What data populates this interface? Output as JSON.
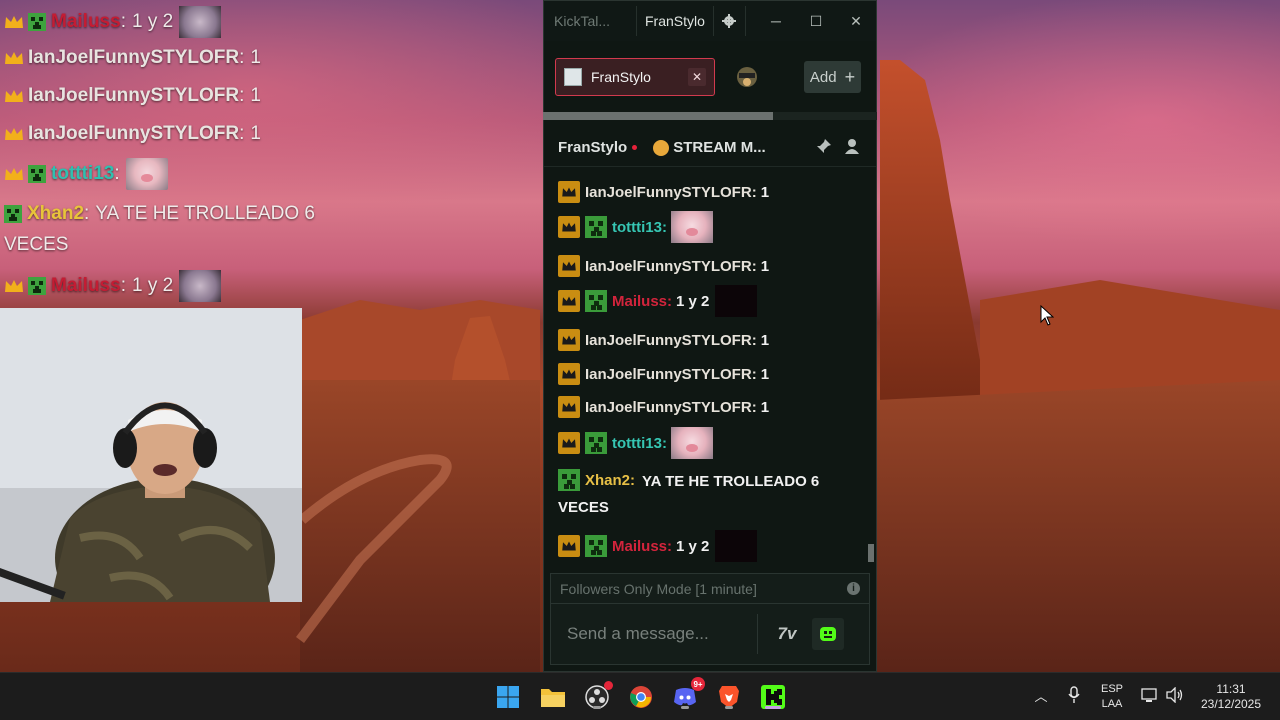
{
  "overlay_chat": {
    "lines": [
      {
        "user": "Mailuss",
        "sep": ":",
        "text": "1 y 2"
      },
      {
        "user": "IanJoelFunnySTYLOFR",
        "sep": ":",
        "text": "1"
      },
      {
        "user": "IanJoelFunnySTYLOFR",
        "sep": ":",
        "text": "1"
      },
      {
        "user": "IanJoelFunnySTYLOFR",
        "sep": ":",
        "text": "1"
      },
      {
        "user": "tottti13",
        "sep": ":",
        "text": ""
      },
      {
        "user": "Xhan2",
        "sep": ":",
        "text": "YA TE HE TROLLEADO 6"
      },
      {
        "user": "",
        "sep": "",
        "text": "VECES"
      },
      {
        "user": "Mailuss",
        "sep": ":",
        "text": "1 y 2"
      }
    ]
  },
  "kicktalk": {
    "app_title": "KickTal...",
    "current_user": "FranStylo",
    "tabs": [
      {
        "label": "FranStylo",
        "active": true
      },
      {
        "label": "",
        "active": false
      }
    ],
    "add_button": "Add",
    "channel": {
      "name": "FranStylo",
      "stream_title": "STREAM M..."
    },
    "messages": [
      {
        "badges": [
          "crown"
        ],
        "user": "IanJoelFunnySTYLOFR",
        "color": "gold",
        "text": "1"
      },
      {
        "badges": [
          "crown",
          "creeper"
        ],
        "user": "tottti13",
        "color": "teal",
        "text": "",
        "emote": "pig"
      },
      {
        "badges": [
          "crown"
        ],
        "user": "IanJoelFunnySTYLOFR",
        "color": "gold",
        "text": "1"
      },
      {
        "badges": [
          "crown",
          "creeper"
        ],
        "user": "Mailuss",
        "color": "red",
        "text": "1 y 2",
        "emote": "dark"
      },
      {
        "badges": [
          "crown"
        ],
        "user": "IanJoelFunnySTYLOFR",
        "color": "gold",
        "text": "1"
      },
      {
        "badges": [
          "crown"
        ],
        "user": "IanJoelFunnySTYLOFR",
        "color": "gold",
        "text": "1"
      },
      {
        "badges": [
          "crown"
        ],
        "user": "IanJoelFunnySTYLOFR",
        "color": "gold",
        "text": "1"
      },
      {
        "badges": [
          "crown",
          "creeper"
        ],
        "user": "tottti13",
        "color": "teal",
        "text": "",
        "emote": "pig"
      },
      {
        "badges": [
          "creeper"
        ],
        "user": "Xhan2",
        "color": "yellow",
        "text": "YA TE HE TROLLEADO 6 VECES"
      },
      {
        "badges": [
          "crown",
          "creeper"
        ],
        "user": "Mailuss",
        "color": "red",
        "text": "1 y 2",
        "emote": "dark"
      }
    ],
    "followers_mode": "Followers Only Mode [1 minute]",
    "input_placeholder": "Send a message...",
    "emote_button_7tv": "7v"
  },
  "taskbar": {
    "apps": [
      "start",
      "file-explorer",
      "obs",
      "chrome",
      "discord",
      "brave",
      "kicktalk"
    ],
    "discord_badge": "9+",
    "language_top": "ESP",
    "language_bottom": "LAA",
    "time": "11:31",
    "date": "23/12/2025"
  },
  "colors": {
    "kick_green": "#53fc18",
    "user_red": "#d2243c",
    "user_teal": "#36c6b3",
    "user_yellow": "#e7c046",
    "crown_gold": "#c98d12"
  }
}
